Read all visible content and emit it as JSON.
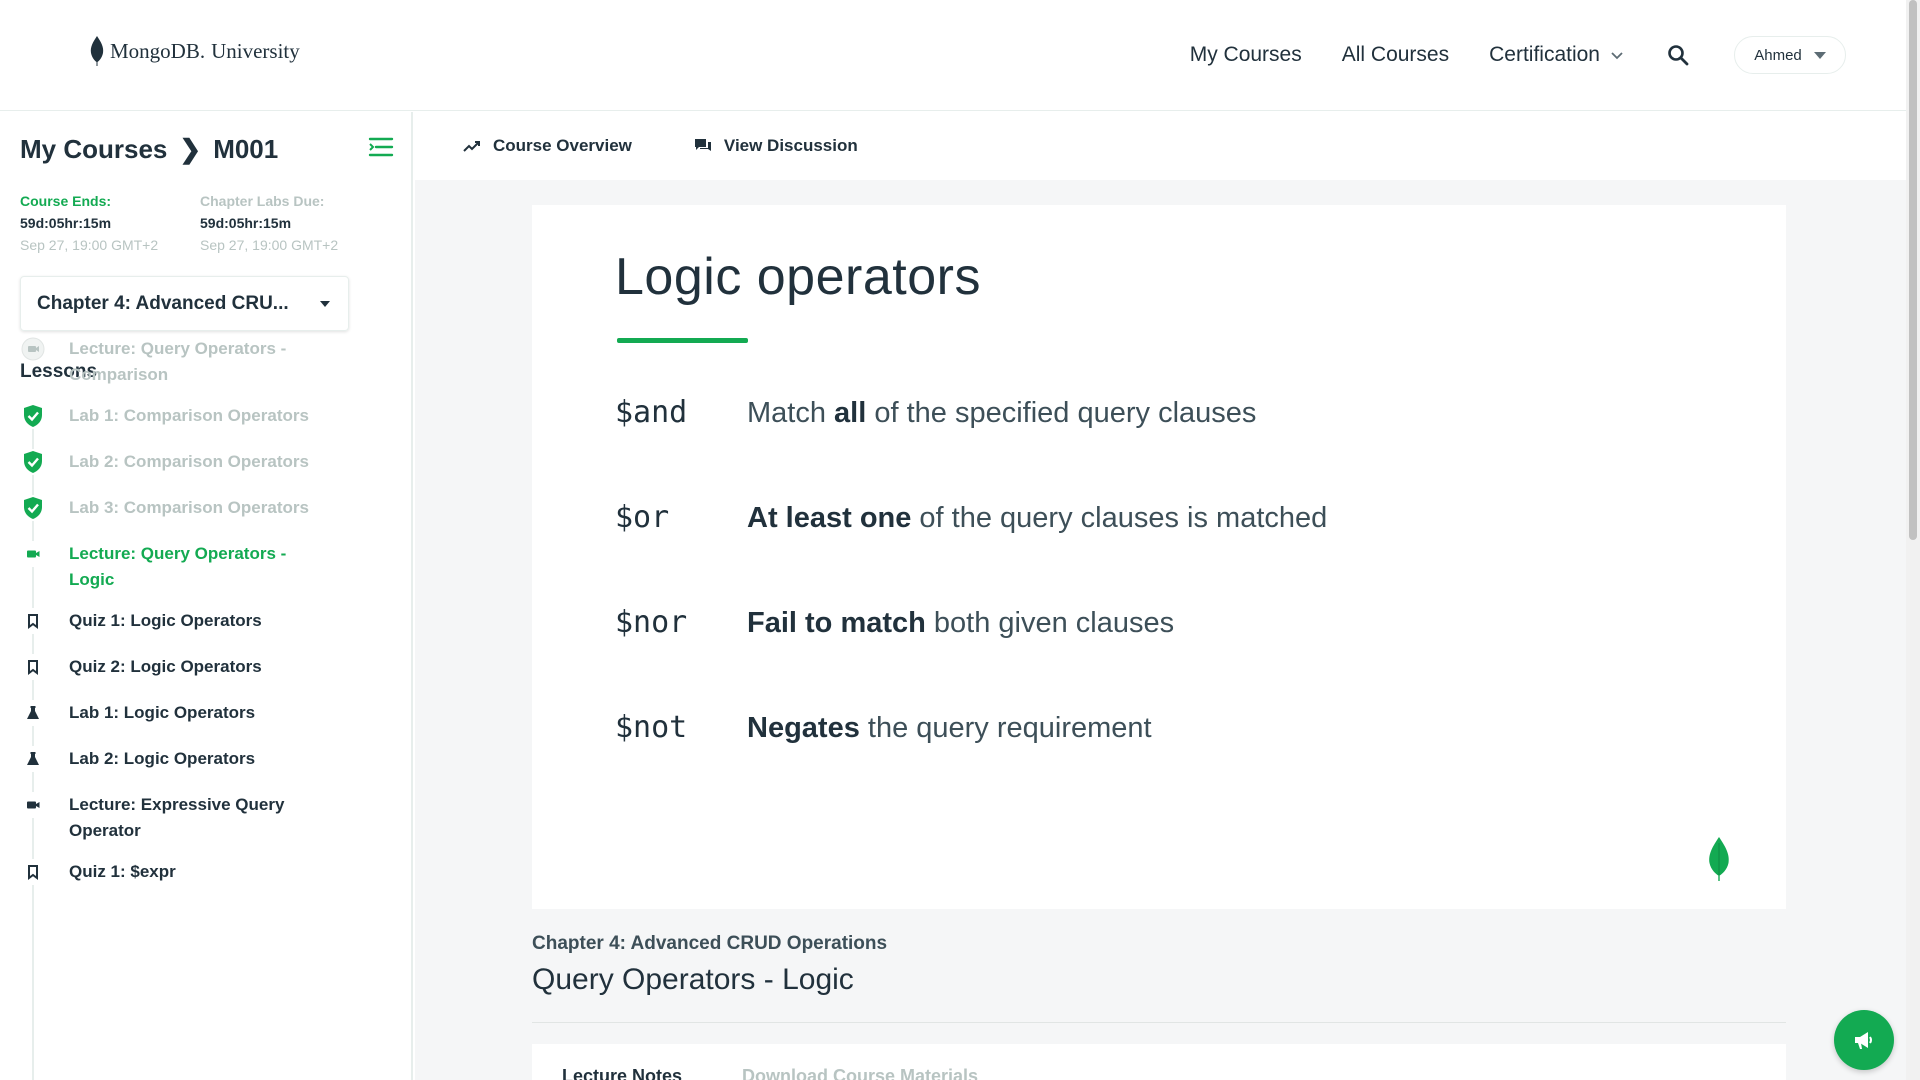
{
  "header": {
    "brand": "MongoDB.",
    "brand_sub": "University",
    "nav": {
      "my_courses": "My Courses",
      "all_courses": "All Courses",
      "certification": "Certification"
    },
    "user": "Ahmed"
  },
  "sidebar": {
    "breadcrumb": {
      "root": "My Courses",
      "sep": "❯",
      "course": "M001"
    },
    "course_ends": {
      "label": "Course Ends:",
      "countdown": "59d:05hr:15m",
      "date": "Sep 27, 19:00 GMT+2"
    },
    "labs_due": {
      "label": "Chapter Labs Due:",
      "countdown": "59d:05hr:15m",
      "date": "Sep 27, 19:00 GMT+2"
    },
    "chapter_select": "Chapter 4: Advanced CRU...",
    "lessons_title": "Lessons",
    "lessons": [
      {
        "label": "Lecture: Query Operators - Comparison",
        "status": "done",
        "icon": "video-icon"
      },
      {
        "label": "Lab 1: Comparison Operators",
        "status": "done",
        "icon": "check-shield-icon"
      },
      {
        "label": "Lab 2: Comparison Operators",
        "status": "done",
        "icon": "check-shield-icon"
      },
      {
        "label": "Lab 3: Comparison Operators",
        "status": "done",
        "icon": "check-shield-icon"
      },
      {
        "label": "Lecture: Query Operators - Logic",
        "status": "active",
        "icon": "video-icon"
      },
      {
        "label": "Quiz 1: Logic Operators",
        "status": "todo",
        "icon": "bookmark-icon"
      },
      {
        "label": "Quiz 2: Logic Operators",
        "status": "todo",
        "icon": "bookmark-icon"
      },
      {
        "label": "Lab 1: Logic Operators",
        "status": "todo",
        "icon": "flask-icon"
      },
      {
        "label": "Lab 2: Logic Operators",
        "status": "todo",
        "icon": "flask-icon"
      },
      {
        "label": "Lecture: Expressive Query Operator",
        "status": "todo",
        "icon": "video-icon"
      },
      {
        "label": "Quiz 1: $expr",
        "status": "todo",
        "icon": "bookmark-icon"
      }
    ]
  },
  "tabs": {
    "course_overview": "Course Overview",
    "view_discussion": "View Discussion"
  },
  "slide": {
    "title": "Logic operators",
    "rows": [
      {
        "op": "$and",
        "pre": "Match ",
        "bold": "all",
        "post": " of the specified query clauses"
      },
      {
        "op": "$or",
        "pre": "",
        "bold": "At least one",
        "post": " of the query clauses is matched"
      },
      {
        "op": "$nor",
        "pre": "",
        "bold": "Fail to match",
        "post": " both given clauses"
      },
      {
        "op": "$not",
        "pre": "",
        "bold": "Negates",
        "post": " the query requirement"
      }
    ]
  },
  "lesson": {
    "chapter": "Chapter 4: Advanced CRUD Operations",
    "title": "Query Operators - Logic",
    "tab_notes": "Lecture Notes",
    "tab_materials": "Download Course Materials"
  },
  "colors": {
    "accent": "#13aa52",
    "text": "#21313c",
    "muted": "#b8c4c2"
  }
}
